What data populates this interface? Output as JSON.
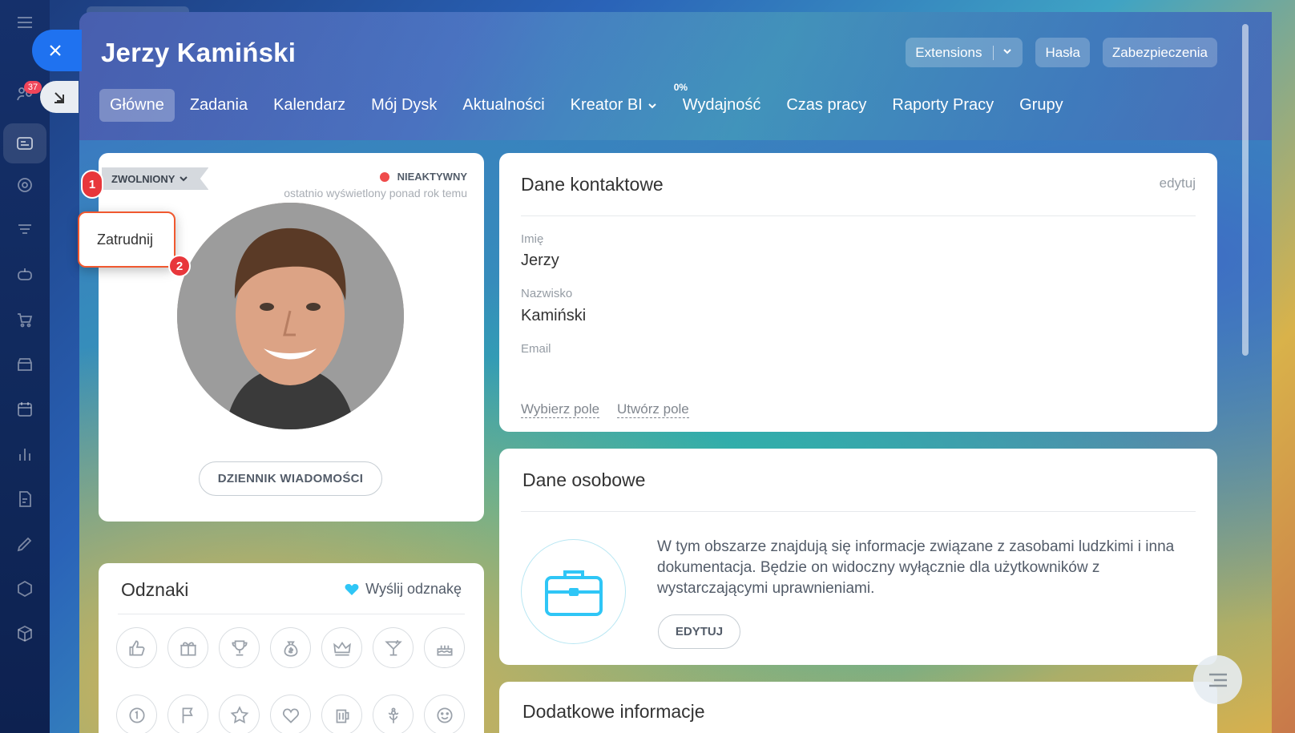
{
  "sidebar": {
    "notifications_badge": "37"
  },
  "header": {
    "title": "Jerzy Kamiński",
    "buttons": {
      "extensions": "Extensions",
      "passwords": "Hasła",
      "security": "Zabezpieczenia"
    }
  },
  "tabs": [
    {
      "label": "Główne"
    },
    {
      "label": "Zadania"
    },
    {
      "label": "Kalendarz"
    },
    {
      "label": "Mój Dysk"
    },
    {
      "label": "Aktualności"
    },
    {
      "label": "Kreator BI"
    },
    {
      "label": "Wydajność",
      "sup": "0%"
    },
    {
      "label": "Czas pracy"
    },
    {
      "label": "Raporty Pracy"
    },
    {
      "label": "Grupy"
    }
  ],
  "profile": {
    "status": "ZWOLNIONY",
    "online_state": "NIEAKTYWNY",
    "last_seen": "ostatnio wyświetlony ponad rok temu",
    "popup_item": "Zatrudnij",
    "log_button": "DZIENNIK WIADOMOŚCI",
    "steps": [
      "1",
      "2"
    ]
  },
  "badges": {
    "title": "Odznaki",
    "send_label": "Wyślij odznakę",
    "icons": [
      "thumbs-up-icon",
      "gift-icon",
      "trophy-icon",
      "money-bag-icon",
      "crown-icon",
      "cocktail-icon",
      "cake-icon",
      "number-one-icon",
      "flag-icon",
      "star-icon",
      "heart-icon",
      "beer-icon",
      "flower-icon",
      "smile-icon"
    ]
  },
  "contact": {
    "title": "Dane kontaktowe",
    "edit_label": "edytuj",
    "fields": [
      {
        "label": "Imię",
        "value": "Jerzy"
      },
      {
        "label": "Nazwisko",
        "value": "Kamiński"
      },
      {
        "label": "Email",
        "value": ""
      }
    ],
    "select_field": "Wybierz pole",
    "create_field": "Utwórz pole"
  },
  "personal": {
    "title": "Dane osobowe",
    "text": "W tym obszarze znajdują się informacje związane z zasobami ludzkimi i inna dokumentacja. Będzie on widoczny wyłącznie dla użytkowników z wystarczającymi uprawnieniami.",
    "edit_button": "EDYTUJ"
  },
  "extra": {
    "title": "Dodatkowe informacje"
  },
  "colors": {
    "accent_blue": "#1f72f0",
    "danger": "#e8363b",
    "offline_dot": "#ef4b4b",
    "badge_heart": "#2fc6f6"
  }
}
